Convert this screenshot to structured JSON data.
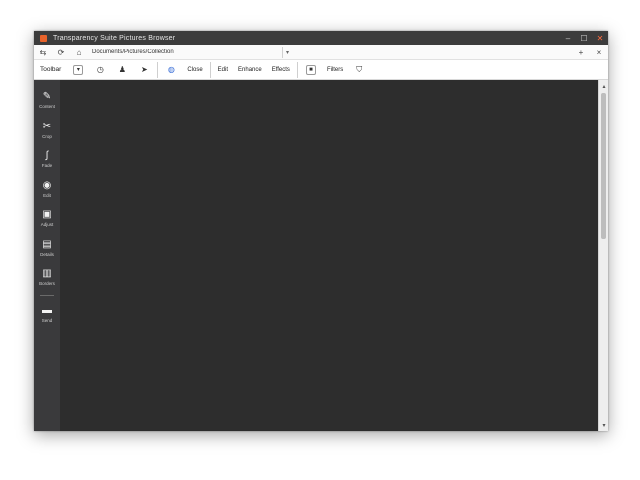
{
  "window": {
    "title": "Transparency Suite Pictures Browser",
    "controls": {
      "minimize": "–",
      "maximize": "☐",
      "close": "✕"
    }
  },
  "addressbar": {
    "address": "Documents/Pictures/Collection",
    "dropdown": "▾",
    "new_tab": "+",
    "close_tab": "×"
  },
  "toolbar": {
    "label": "Toolbar",
    "close": "Close",
    "items": [
      "Edit",
      "Enhance",
      "Effects"
    ],
    "filters": "Filters"
  },
  "sidebar": {
    "items": [
      {
        "label": "Content",
        "icon": "✎"
      },
      {
        "label": "Crop",
        "icon": "✂"
      },
      {
        "label": "Fade",
        "icon": "∫"
      },
      {
        "label": "Edit",
        "icon": "◉"
      },
      {
        "label": "Adjust",
        "icon": "▣"
      },
      {
        "label": "Details",
        "icon": "▤"
      },
      {
        "label": "Borders",
        "icon": "▥"
      },
      {
        "label": "Send",
        "icon": "▬"
      }
    ]
  },
  "colors": {
    "titlebar": "#3c3c3c",
    "accent": "#e8632b",
    "sidebar": "#3a3a3c",
    "canvas": "#2d2d2d"
  }
}
